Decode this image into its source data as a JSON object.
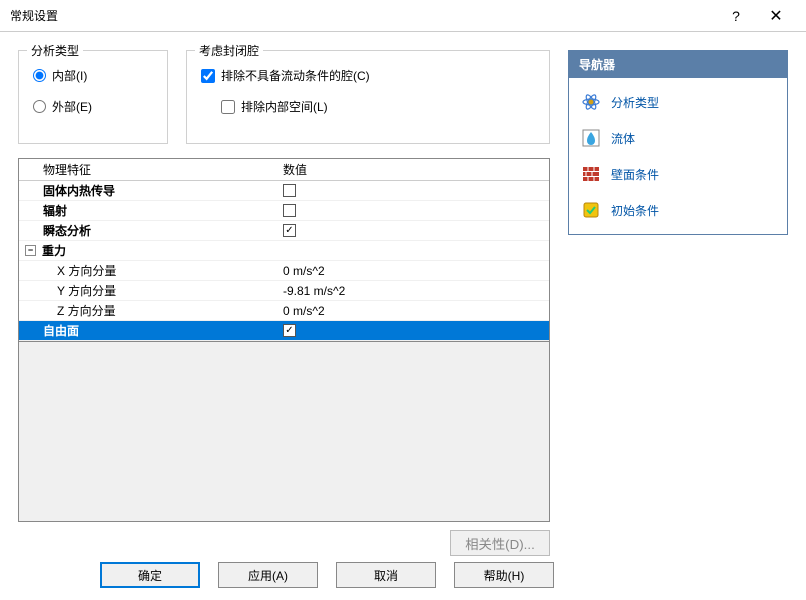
{
  "title": "常规设置",
  "fieldsets": {
    "analysis_type": {
      "legend": "分析类型",
      "options": {
        "internal": "内部(I)",
        "external": "外部(E)"
      },
      "selected": "internal"
    },
    "cavity": {
      "legend": "考虑封闭腔",
      "exclude_no_flow": {
        "label": "排除不具备流动条件的腔(C)",
        "checked": true
      },
      "exclude_internal": {
        "label": "排除内部空间(L)",
        "checked": false
      }
    }
  },
  "table": {
    "headers": {
      "col1": "物理特征",
      "col2": "数值"
    },
    "rows": [
      {
        "label": "固体内热传导",
        "bold": true,
        "value_type": "checkbox",
        "checked": false
      },
      {
        "label": "辐射",
        "bold": true,
        "value_type": "checkbox",
        "checked": false
      },
      {
        "label": "瞬态分析",
        "bold": true,
        "value_type": "checkbox",
        "checked": true
      },
      {
        "label": "重力",
        "bold": true,
        "value_type": "none",
        "expandable": true,
        "expanded": true
      },
      {
        "label": "X 方向分量",
        "sub": true,
        "value_type": "text",
        "value": "0 m/s^2"
      },
      {
        "label": "Y 方向分量",
        "sub": true,
        "value_type": "text",
        "value": "-9.81 m/s^2"
      },
      {
        "label": "Z 方向分量",
        "sub": true,
        "value_type": "text",
        "value": "0 m/s^2"
      },
      {
        "label": "自由面",
        "bold": true,
        "value_type": "checkbox",
        "checked": true,
        "selected": true
      }
    ]
  },
  "related_button": "相关性(D)...",
  "navigator": {
    "title": "导航器",
    "items": [
      {
        "id": "analysis-type",
        "label": "分析类型"
      },
      {
        "id": "fluid",
        "label": "流体"
      },
      {
        "id": "wall-condition",
        "label": "壁面条件"
      },
      {
        "id": "initial-condition",
        "label": "初始条件"
      }
    ]
  },
  "buttons": {
    "ok": "确定",
    "apply": "应用(A)",
    "cancel": "取消",
    "help": "帮助(H)"
  }
}
